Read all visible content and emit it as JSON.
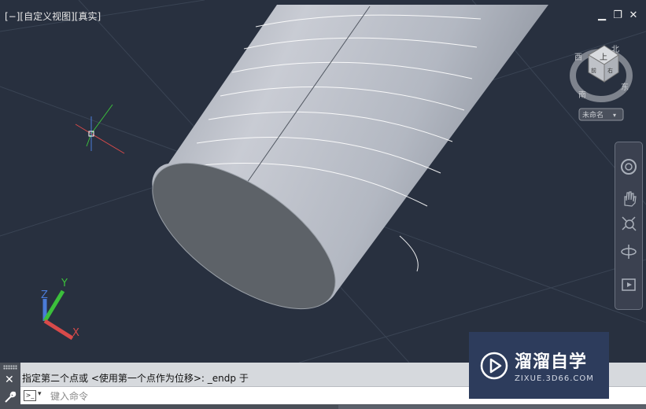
{
  "viewport": {
    "controls": {
      "minus": "[−]",
      "view": "[自定义视图]",
      "style": "[真实]"
    },
    "window_buttons": [
      "▁",
      "❐",
      "✕"
    ]
  },
  "viewcube": {
    "face_top": "上",
    "face_front": "前",
    "face_right": "右",
    "north": "北",
    "east": "东",
    "south": "南",
    "west": "西",
    "ucs_menu": "未命名"
  },
  "ucs": {
    "x": "X",
    "y": "Y",
    "z": "Z"
  },
  "command_line": {
    "history": "指定第二个点或 <使用第一个点作为位移>: _endp 于",
    "prompt_icon": ">_",
    "placeholder": "键入命令",
    "close": "✕"
  },
  "watermark": {
    "title": "溜溜自学",
    "url": "ZIXUE.3D66.COM"
  },
  "colors": {
    "background": "#28303f",
    "solid": "#b9bec8",
    "command_bar": "#d6d9dd"
  }
}
